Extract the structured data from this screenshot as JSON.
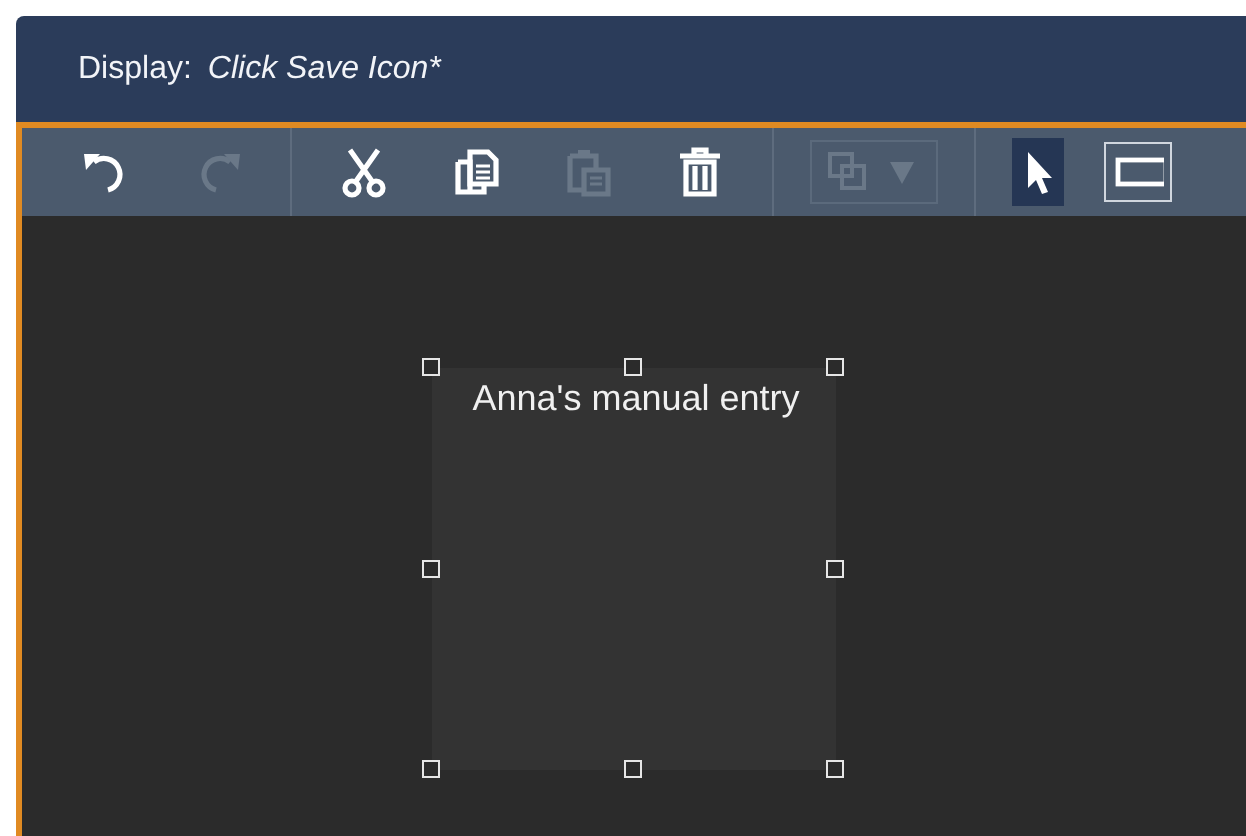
{
  "header": {
    "label": "Display:",
    "title": "Click Save Icon*"
  },
  "toolbar": [
    {
      "kind": "undo",
      "disabled": false,
      "selected": false
    },
    {
      "kind": "redo",
      "disabled": true,
      "selected": false
    },
    {
      "kind": "separator"
    },
    {
      "kind": "cut",
      "disabled": false,
      "selected": false
    },
    {
      "kind": "copy",
      "disabled": false,
      "selected": false
    },
    {
      "kind": "paste",
      "disabled": true,
      "selected": false
    },
    {
      "kind": "delete",
      "disabled": false,
      "selected": false
    },
    {
      "kind": "separator"
    },
    {
      "kind": "arrange",
      "disabled": true,
      "selected": false
    },
    {
      "kind": "separator"
    },
    {
      "kind": "pointer",
      "disabled": false,
      "selected": true
    },
    {
      "kind": "rectangle",
      "disabled": false,
      "selected": false
    }
  ],
  "canvas": {
    "elements": [
      {
        "text": "Anna's manual entry",
        "selected": true
      }
    ]
  }
}
